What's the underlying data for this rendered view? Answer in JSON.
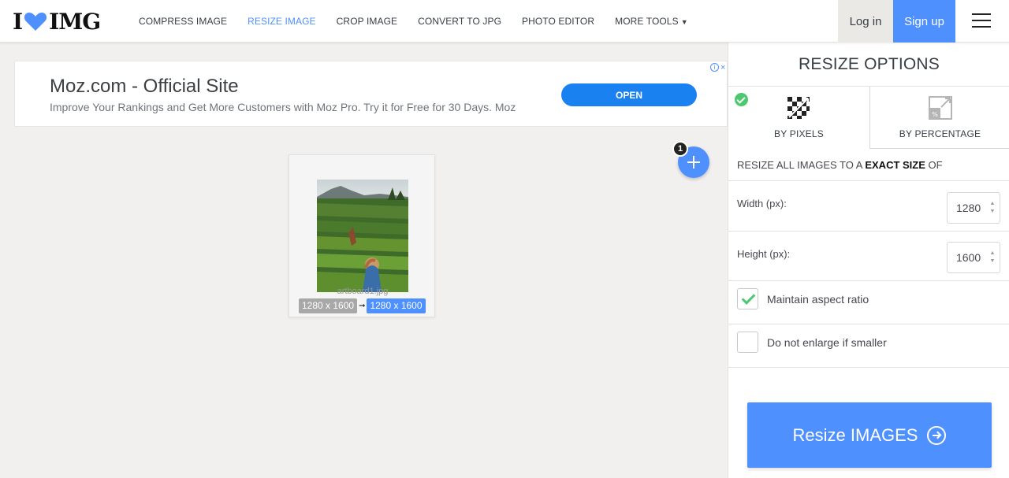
{
  "header": {
    "logo_left": "I",
    "logo_right": "IMG",
    "nav": [
      {
        "label": "COMPRESS IMAGE"
      },
      {
        "label": "RESIZE IMAGE"
      },
      {
        "label": "CROP IMAGE"
      },
      {
        "label": "CONVERT TO JPG"
      },
      {
        "label": "PHOTO EDITOR"
      },
      {
        "label": "MORE TOOLS"
      }
    ],
    "login_label": "Log in",
    "signup_label": "Sign up",
    "colors": {
      "accent": "#4d90fe"
    }
  },
  "ad": {
    "title": "Moz.com - Official Site",
    "description": "Improve Your Rankings and Get More Customers with Moz Pro. Try it for Free for 30 Days. Moz",
    "button_label": "OPEN",
    "close_glyph": "×"
  },
  "files": {
    "count": "1",
    "items": [
      {
        "name": "artboard1.jpg",
        "original_size": "1280 x 1600",
        "new_size": "1280 x 1600"
      }
    ]
  },
  "sidebar": {
    "title": "RESIZE OPTIONS",
    "tabs": [
      {
        "label": "BY PIXELS",
        "selected": true
      },
      {
        "label": "BY PERCENTAGE",
        "selected": false
      }
    ],
    "resize_prefix": "RESIZE ALL IMAGES TO A ",
    "resize_emphasis": "EXACT SIZE",
    "resize_suffix": " OF",
    "width_label": "Width (px):",
    "width_value": "1280",
    "height_label": "Height (px):",
    "height_value": "1600",
    "maintain_label": "Maintain aspect ratio",
    "maintain_checked": true,
    "no_enlarge_label": "Do not enlarge if smaller",
    "no_enlarge_checked": false,
    "submit_label": "Resize IMAGES"
  }
}
